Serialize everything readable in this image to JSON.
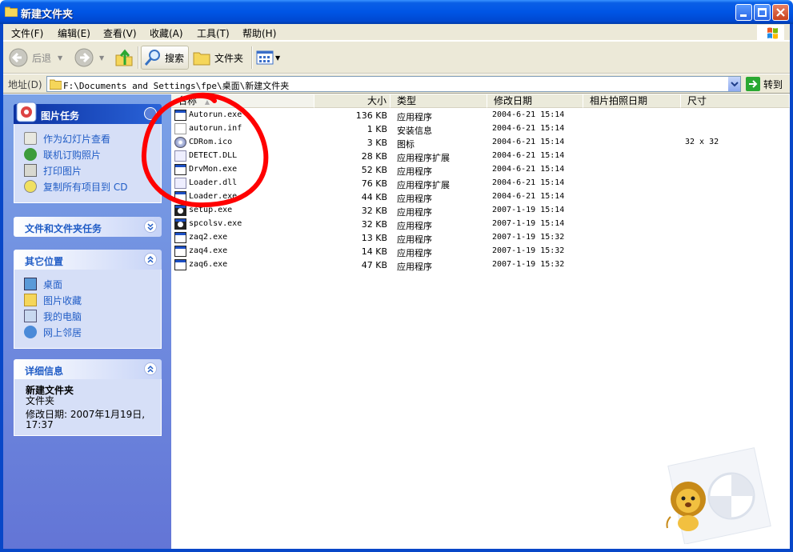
{
  "window": {
    "title": "新建文件夹"
  },
  "menu": [
    "文件(F)",
    "编辑(E)",
    "查看(V)",
    "收藏(A)",
    "工具(T)",
    "帮助(H)"
  ],
  "toolbar": {
    "back_label": "后退",
    "search_label": "搜索",
    "folders_label": "文件夹"
  },
  "address": {
    "label": "地址(D)",
    "path": "F:\\Documents and Settings\\fpe\\桌面\\新建文件夹",
    "go_label": "转到"
  },
  "taskpane": {
    "picture_tasks": {
      "title": "图片任务",
      "links": [
        "作为幻灯片查看",
        "联机订购照片",
        "打印图片",
        "复制所有项目到 CD"
      ]
    },
    "file_tasks": {
      "title": "文件和文件夹任务"
    },
    "other_places": {
      "title": "其它位置",
      "links": [
        "桌面",
        "图片收藏",
        "我的电脑",
        "网上邻居"
      ]
    },
    "details": {
      "title": "详细信息",
      "name": "新建文件夹",
      "type": "文件夹",
      "modified": "修改日期: 2007年1月19日, 17:37"
    }
  },
  "columns": [
    "名称",
    "大小",
    "类型",
    "修改日期",
    "相片拍照日期",
    "尺寸"
  ],
  "files": [
    {
      "name": "Autorun.exe",
      "size": "136 KB",
      "type": "应用程序",
      "date": "2004-6-21 15:14",
      "dim": "",
      "icon": "exe-icon"
    },
    {
      "name": "autorun.inf",
      "size": "1 KB",
      "type": "安装信息",
      "date": "2004-6-21 15:14",
      "dim": "",
      "icon": "inf-icon"
    },
    {
      "name": "CDRom.ico",
      "size": "3 KB",
      "type": "图标",
      "date": "2004-6-21 15:14",
      "dim": "32 x 32",
      "icon": "cd-icon"
    },
    {
      "name": "DETECT.DLL",
      "size": "28 KB",
      "type": "应用程序扩展",
      "date": "2004-6-21 15:14",
      "dim": "",
      "icon": "dll-icon"
    },
    {
      "name": "DrvMon.exe",
      "size": "52 KB",
      "type": "应用程序",
      "date": "2004-6-21 15:14",
      "dim": "",
      "icon": "exe-icon"
    },
    {
      "name": "Loader.dll",
      "size": "76 KB",
      "type": "应用程序扩展",
      "date": "2004-6-21 15:14",
      "dim": "",
      "icon": "dll-icon"
    },
    {
      "name": "Loader.exe",
      "size": "44 KB",
      "type": "应用程序",
      "date": "2004-6-21 15:14",
      "dim": "",
      "icon": "exe-icon"
    },
    {
      "name": "setup.exe",
      "size": "32 KB",
      "type": "应用程序",
      "date": "2007-1-19 15:14",
      "dim": "",
      "icon": "panda-icon"
    },
    {
      "name": "spcolsv.exe",
      "size": "32 KB",
      "type": "应用程序",
      "date": "2007-1-19 15:14",
      "dim": "",
      "icon": "panda-icon"
    },
    {
      "name": "zaq2.exe",
      "size": "13 KB",
      "type": "应用程序",
      "date": "2007-1-19 15:32",
      "dim": "",
      "icon": "exe-icon"
    },
    {
      "name": "zaq4.exe",
      "size": "14 KB",
      "type": "应用程序",
      "date": "2007-1-19 15:32",
      "dim": "",
      "icon": "exe-icon"
    },
    {
      "name": "zaq6.exe",
      "size": "47 KB",
      "type": "应用程序",
      "date": "2007-1-19 15:32",
      "dim": "",
      "icon": "exe-icon"
    }
  ],
  "colors": {
    "title_blue": "#0055e5",
    "task_link": "#215dc6",
    "annotation_red": "#ff0000"
  }
}
